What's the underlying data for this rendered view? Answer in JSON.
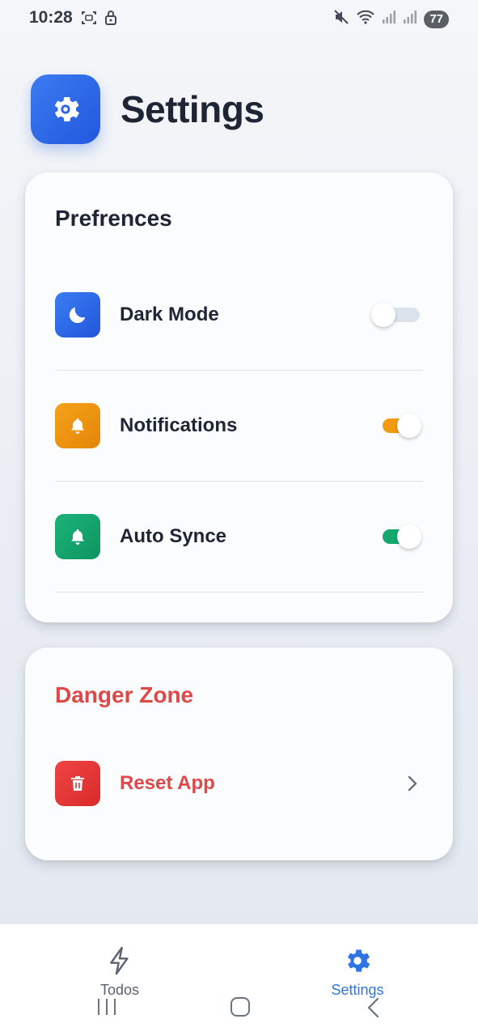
{
  "status_bar": {
    "time": "10:28",
    "battery": "77",
    "icons": [
      "screenshot-icon",
      "lock-icon",
      "mute-icon",
      "wifi-icon",
      "signal-icon",
      "signal-icon"
    ]
  },
  "header": {
    "title": "Settings",
    "icon": "gear-icon"
  },
  "preferences": {
    "title": "Prefrences",
    "items": [
      {
        "label": "Dark Mode",
        "icon": "moon-icon",
        "enabled": false,
        "color": "#2b63e6"
      },
      {
        "label": "Notifications",
        "icon": "bell-icon",
        "enabled": true,
        "color": "#f29b10"
      },
      {
        "label": "Auto Synce",
        "icon": "bell-icon",
        "enabled": true,
        "color": "#17a86e"
      }
    ]
  },
  "danger_zone": {
    "title": "Danger Zone",
    "items": [
      {
        "label": "Reset App",
        "icon": "trash-icon",
        "color": "#e04848"
      }
    ]
  },
  "bottom_nav": {
    "tabs": [
      {
        "label": "Todos",
        "icon": "lightning-icon",
        "active": false
      },
      {
        "label": "Settings",
        "icon": "gear-icon",
        "active": true
      }
    ],
    "active_color": "#2f74e4"
  },
  "system_nav": [
    "recents-button",
    "home-button",
    "back-button"
  ]
}
